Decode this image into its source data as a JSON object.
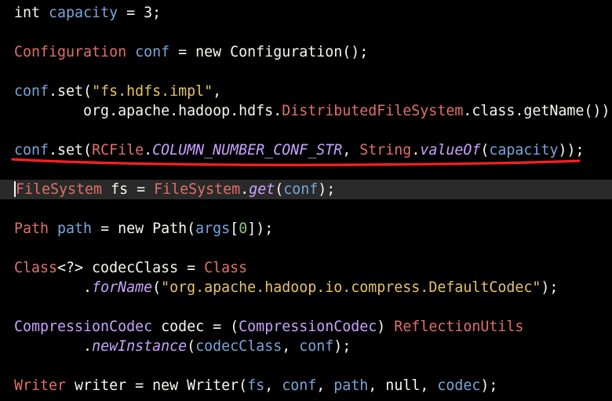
{
  "colors": {
    "background": "#000000",
    "text": "#f8f8f2",
    "type": "#e0706a",
    "var": "#7aa6da",
    "string": "#e6c660",
    "method_italic": "#c9a3ff",
    "green": "#8ec07c",
    "annotation": "#ff1f1f"
  },
  "code": [
    {
      "tokens": [
        {
          "t": "int ",
          "c": "text"
        },
        {
          "t": "capacity",
          "c": "var"
        },
        {
          "t": " = ",
          "c": "text"
        },
        {
          "t": "3",
          "c": "text"
        },
        {
          "t": ";",
          "c": "text"
        }
      ]
    },
    {
      "tokens": [
        {
          "t": "Configuration ",
          "c": "type"
        },
        {
          "t": "conf",
          "c": "var"
        },
        {
          "t": " = new Configuration();",
          "c": "text"
        }
      ]
    },
    {
      "tokens": [
        {
          "t": "conf",
          "c": "var"
        },
        {
          "t": ".set(",
          "c": "text"
        },
        {
          "t": "\"fs.hdfs.impl\"",
          "c": "string"
        },
        {
          "t": ",",
          "c": "text"
        }
      ]
    },
    {
      "tokens": [
        {
          "t": "        org.apache.hadoop.hdfs.",
          "c": "text"
        },
        {
          "t": "DistributedFileSystem",
          "c": "type"
        },
        {
          "t": ".class.getName());",
          "c": "text"
        }
      ]
    },
    {
      "tokens": [
        {
          "t": "conf",
          "c": "var"
        },
        {
          "t": ".set(",
          "c": "text"
        },
        {
          "t": "RCFile",
          "c": "type"
        },
        {
          "t": ".",
          "c": "text"
        },
        {
          "t": "COLUMN_NUMBER_CONF_STR",
          "c": "method_italic"
        },
        {
          "t": ", ",
          "c": "text"
        },
        {
          "t": "String",
          "c": "type"
        },
        {
          "t": ".",
          "c": "text"
        },
        {
          "t": "valueOf",
          "c": "method_italic"
        },
        {
          "t": "(",
          "c": "text"
        },
        {
          "t": "capacity",
          "c": "var"
        },
        {
          "t": "));",
          "c": "text"
        }
      ]
    },
    {
      "tokens": [
        {
          "t": "FileSystem",
          "c": "type"
        },
        {
          "t": " fs = ",
          "c": "text"
        },
        {
          "t": "FileSystem",
          "c": "type"
        },
        {
          "t": ".",
          "c": "text"
        },
        {
          "t": "get",
          "c": "method_italic"
        },
        {
          "t": "(",
          "c": "text"
        },
        {
          "t": "conf",
          "c": "var"
        },
        {
          "t": ");",
          "c": "text"
        }
      ]
    },
    {
      "tokens": [
        {
          "t": "Path ",
          "c": "type"
        },
        {
          "t": "path",
          "c": "var"
        },
        {
          "t": " = new Path(",
          "c": "text"
        },
        {
          "t": "args",
          "c": "var"
        },
        {
          "t": "[",
          "c": "text"
        },
        {
          "t": "0",
          "c": "green"
        },
        {
          "t": "]);",
          "c": "text"
        }
      ]
    },
    {
      "tokens": [
        {
          "t": "Class",
          "c": "type"
        },
        {
          "t": "<?> codecClass = ",
          "c": "text"
        },
        {
          "t": "Class",
          "c": "type"
        }
      ]
    },
    {
      "tokens": [
        {
          "t": "        .",
          "c": "text"
        },
        {
          "t": "forName",
          "c": "method_italic"
        },
        {
          "t": "(",
          "c": "text"
        },
        {
          "t": "\"org.apache.hadoop.io.compress.DefaultCodec\"",
          "c": "string"
        },
        {
          "t": ");",
          "c": "text"
        }
      ]
    },
    {
      "tokens": [
        {
          "t": "CompressionCodec",
          "c": "method_italic_plain"
        },
        {
          "t": " codec = (",
          "c": "text"
        },
        {
          "t": "CompressionCodec",
          "c": "method_italic_plain"
        },
        {
          "t": ") ",
          "c": "text"
        },
        {
          "t": "ReflectionUtils",
          "c": "type"
        }
      ]
    },
    {
      "tokens": [
        {
          "t": "        .",
          "c": "text"
        },
        {
          "t": "newInstance",
          "c": "method_italic"
        },
        {
          "t": "(",
          "c": "text"
        },
        {
          "t": "codecClass",
          "c": "var"
        },
        {
          "t": ", ",
          "c": "text"
        },
        {
          "t": "conf",
          "c": "var"
        },
        {
          "t": ");",
          "c": "text"
        }
      ]
    },
    {
      "tokens": [
        {
          "t": "Writer",
          "c": "type"
        },
        {
          "t": " writer = new Writer(",
          "c": "text"
        },
        {
          "t": "fs",
          "c": "var"
        },
        {
          "t": ", ",
          "c": "text"
        },
        {
          "t": "conf",
          "c": "var"
        },
        {
          "t": ", ",
          "c": "text"
        },
        {
          "t": "path",
          "c": "var"
        },
        {
          "t": ", null, ",
          "c": "text"
        },
        {
          "t": "codec",
          "c": "var"
        },
        {
          "t": ");",
          "c": "text"
        }
      ]
    }
  ]
}
